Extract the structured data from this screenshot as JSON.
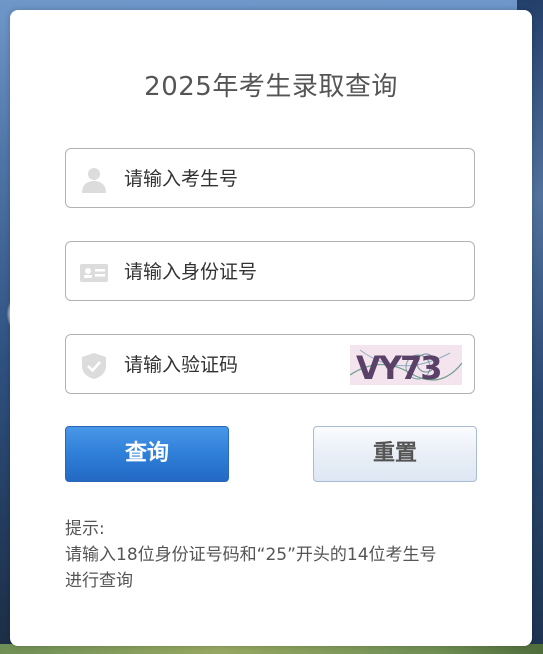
{
  "title": "2025年考生录取查询",
  "fields": {
    "exam_number": {
      "placeholder": "请输入考生号",
      "value": "",
      "icon": "user-icon"
    },
    "id_number": {
      "placeholder": "请输入身份证号",
      "value": "",
      "icon": "id-card-icon"
    },
    "captcha": {
      "placeholder": "请输入验证码",
      "value": "",
      "icon": "shield-icon",
      "captcha_text": "VY73"
    }
  },
  "buttons": {
    "query_label": "查询",
    "reset_label": "重置"
  },
  "tip": {
    "label": "提示:",
    "line1": "请输入18位身份证号码和“25”开头的14位考生号",
    "line2": "进行查询"
  },
  "colors": {
    "primary_button": "#2f7fd8",
    "reset_button": "#e9eff7",
    "text": "#555555",
    "border": "#b3b3b3"
  }
}
